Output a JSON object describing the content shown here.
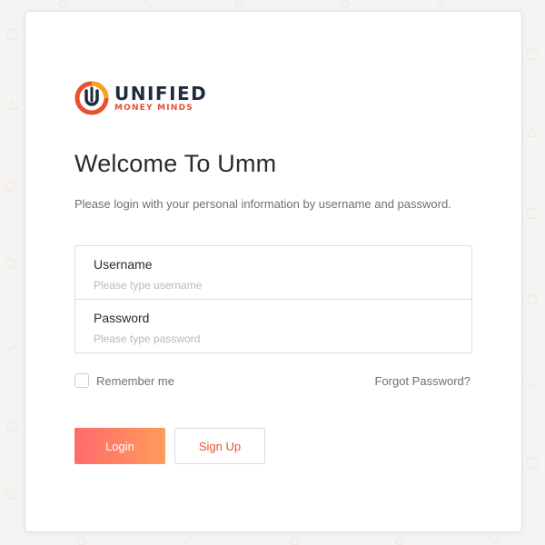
{
  "logo": {
    "line1": "UNIFIED",
    "line2": "MONEY MINDS",
    "icon": "umm-logo-icon",
    "colors": {
      "navy": "#1f2b3a",
      "orange": "#e8502f"
    }
  },
  "header": {
    "title": "Welcome To Umm",
    "subtitle": "Please login with your personal information by username and password."
  },
  "form": {
    "username": {
      "label": "Username",
      "placeholder": "Please type username",
      "value": ""
    },
    "password": {
      "label": "Password",
      "placeholder": "Please type password",
      "value": ""
    },
    "remember_label": "Remember me",
    "remember_checked": false,
    "forgot_label": "Forgot Password?"
  },
  "actions": {
    "login_label": "Login",
    "signup_label": "Sign Up"
  },
  "colors": {
    "accent_start": "#ff6b6b",
    "accent_end": "#ff9a5a",
    "signup_text": "#e8502f",
    "background": "#f6f4f2"
  }
}
